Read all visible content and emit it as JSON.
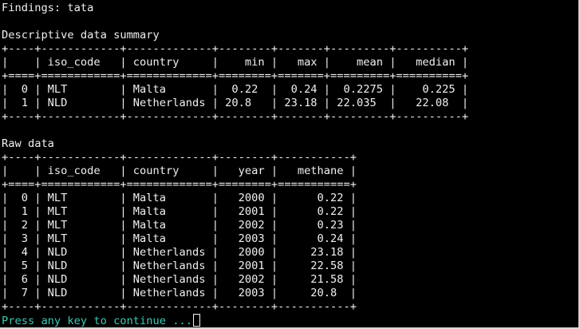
{
  "title_line": "Findings: tata",
  "summary_heading": "Descriptive data summary",
  "summary_table_lines": [
    "+----+------------+-------------+--------+-------+---------+----------+",
    "|    | iso_code   | country     |    min |   max |    mean |   median |",
    "+====+============+=============+========+=======+=========+==========+",
    "|  0 | MLT        | Malta       |  0.22  |  0.24 |  0.2275 |    0.225 |",
    "|  1 | NLD        | Netherlands | 20.8   | 23.18 | 22.035  |   22.08  |",
    "+----+------------+-------------+--------+-------+---------+----------+"
  ],
  "raw_heading": "Raw data",
  "raw_table_lines": [
    "+----+------------+-------------+--------+-----------+",
    "|    | iso_code   | country     |   year |   methane |",
    "+====+============+=============+========+===========+",
    "|  0 | MLT        | Malta       |   2000 |      0.22 |",
    "|  1 | MLT        | Malta       |   2001 |      0.22 |",
    "|  2 | MLT        | Malta       |   2002 |      0.23 |",
    "|  3 | MLT        | Malta       |   2003 |      0.24 |",
    "|  4 | NLD        | Netherlands |   2000 |     23.18 |",
    "|  5 | NLD        | Netherlands |   2001 |     22.58 |",
    "|  6 | NLD        | Netherlands |   2002 |     21.58 |",
    "|  7 | NLD        | Netherlands |   2003 |     20.8  |",
    "+----+------------+-------------+--------+-----------+"
  ],
  "prompt": "Press any key to continue ...",
  "colors": {
    "background": "#000000",
    "text": "#f0f0f0",
    "prompt": "#3cc8b4"
  }
}
